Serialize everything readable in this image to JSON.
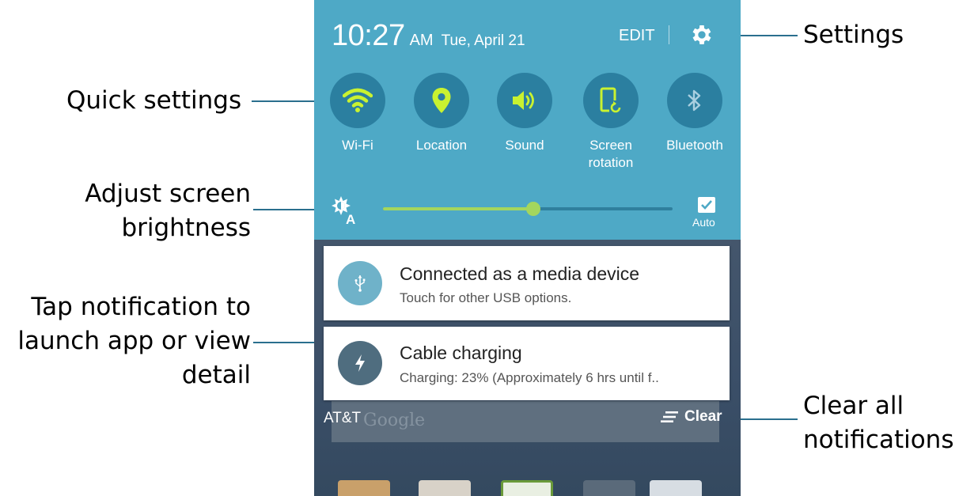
{
  "callouts": {
    "settings": "Settings",
    "quick_settings": "Quick settings",
    "brightness_line1": "Adjust screen",
    "brightness_line2": "brightness",
    "notif_line1": "Tap notification to",
    "notif_line2": "launch app or view",
    "notif_line3": "detail",
    "clear_line1": "Clear all",
    "clear_line2": "notifications"
  },
  "status": {
    "time": "10:27",
    "ampm": "AM",
    "date": "Tue, April 21",
    "edit_label": "EDIT",
    "settings_icon": "gear-icon"
  },
  "quick_settings": [
    {
      "label": "Wi-Fi",
      "icon": "wifi-icon",
      "active": true
    },
    {
      "label": "Location",
      "icon": "location-icon",
      "active": true
    },
    {
      "label": "Sound",
      "icon": "sound-icon",
      "active": true
    },
    {
      "label": "Screen rotation",
      "label_line1": "Screen",
      "label_line2": "rotation",
      "icon": "screen-rotation-icon",
      "active": true
    },
    {
      "label": "Bluetooth",
      "icon": "bluetooth-icon",
      "active": false
    }
  ],
  "brightness": {
    "icon": "auto-brightness-icon",
    "level": 0.52,
    "auto_checked": true,
    "auto_label": "Auto"
  },
  "notifications": [
    {
      "title": "Connected as a media device",
      "subtitle": "Touch for other USB options.",
      "icon": "usb-icon",
      "icon_color": "#6fb2c9"
    },
    {
      "title": "Cable charging",
      "subtitle": "Charging: 23% (Approximately 6 hrs until f..",
      "icon": "charging-bolt-icon",
      "icon_color": "#4f6d7f"
    }
  ],
  "footer": {
    "carrier": "AT&T",
    "clear_label": "Clear",
    "search_logo": "Google"
  },
  "colors": {
    "panel": "#4ea9c6",
    "circle": "#2b7fa0",
    "accent": "#c9f230",
    "slider": "#a4d65e",
    "leader": "#2a6f8e"
  }
}
